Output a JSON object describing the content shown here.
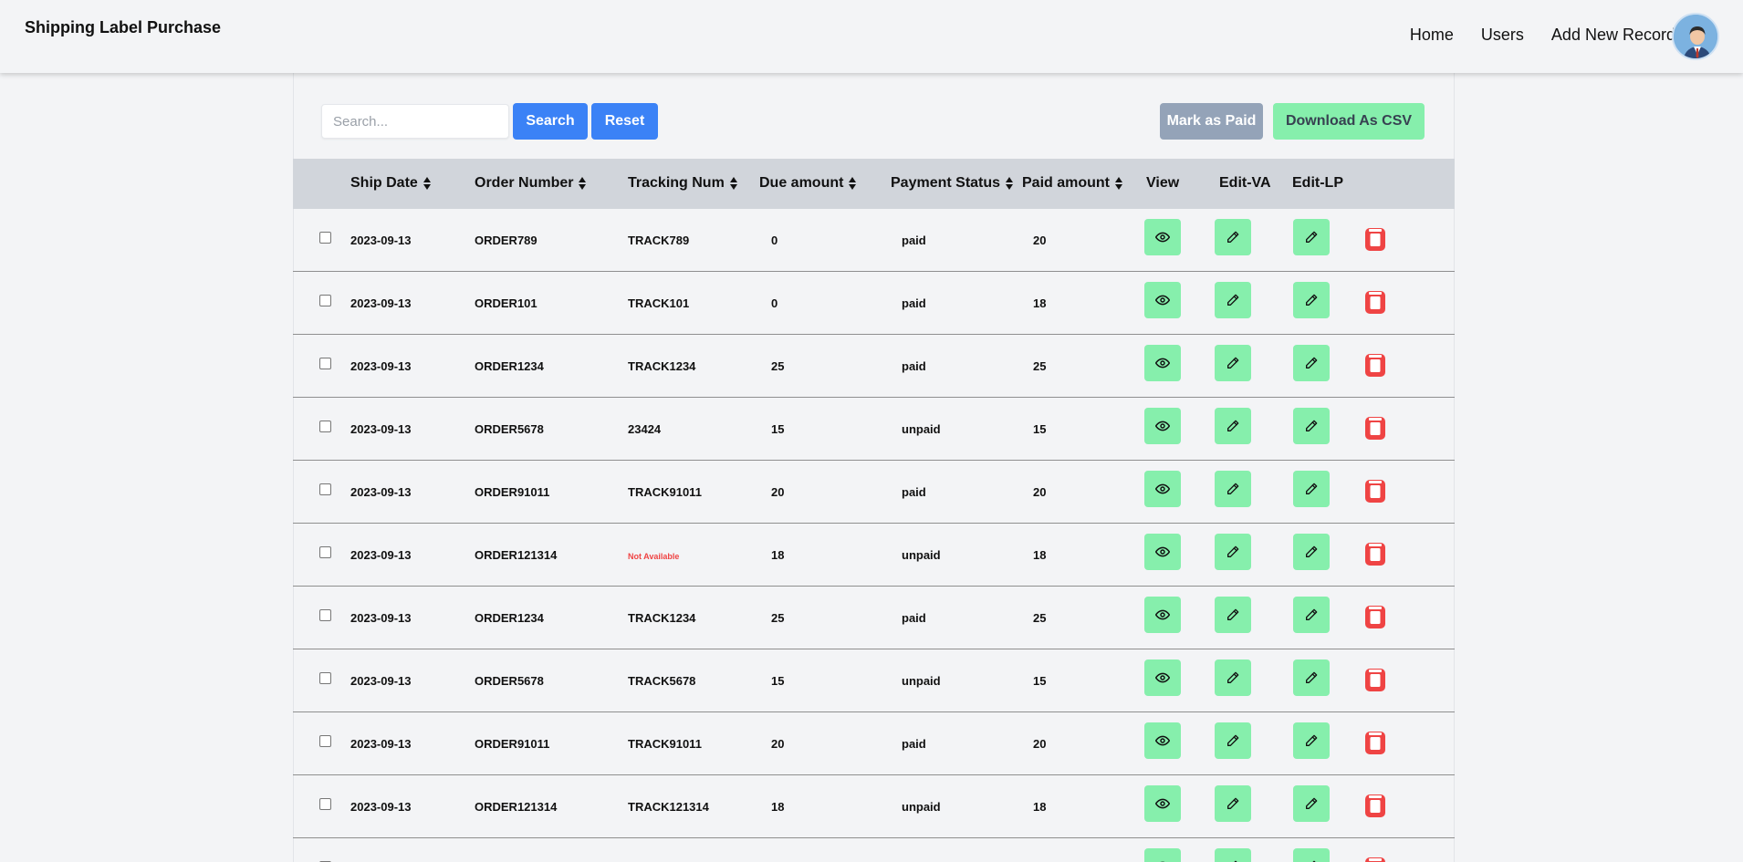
{
  "app": {
    "title": "Shipping Label Purchase",
    "nav": {
      "home": "Home",
      "users": "Users",
      "add_new_record": "Add New Record"
    }
  },
  "toolbar": {
    "search_placeholder": "Search...",
    "search_label": "Search",
    "reset_label": "Reset",
    "mark_paid_label": "Mark as Paid",
    "download_csv_label": "Download As CSV"
  },
  "table": {
    "columns": {
      "ship_date": "Ship Date",
      "order_number": "Order Number",
      "tracking_num": "Tracking Num",
      "due_amount": "Due amount",
      "payment_status": "Payment Status",
      "paid_amount": "Paid amount",
      "view": "View",
      "edit_va": "Edit-VA",
      "edit_lp": "Edit-LP"
    },
    "rows": [
      {
        "ship_date": "2023-09-13",
        "order": "ORDER789",
        "tracking": "TRACK789",
        "due": "0",
        "status": "paid",
        "paid": "20"
      },
      {
        "ship_date": "2023-09-13",
        "order": "ORDER101",
        "tracking": "TRACK101",
        "due": "0",
        "status": "paid",
        "paid": "18"
      },
      {
        "ship_date": "2023-09-13",
        "order": "ORDER1234",
        "tracking": "TRACK1234",
        "due": "25",
        "status": "paid",
        "paid": "25"
      },
      {
        "ship_date": "2023-09-13",
        "order": "ORDER5678",
        "tracking": "23424",
        "due": "15",
        "status": "unpaid",
        "paid": "15"
      },
      {
        "ship_date": "2023-09-13",
        "order": "ORDER91011",
        "tracking": "TRACK91011",
        "due": "20",
        "status": "paid",
        "paid": "20"
      },
      {
        "ship_date": "2023-09-13",
        "order": "ORDER121314",
        "tracking": "Not Available",
        "tracking_na": true,
        "due": "18",
        "status": "unpaid",
        "paid": "18"
      },
      {
        "ship_date": "2023-09-13",
        "order": "ORDER1234",
        "tracking": "TRACK1234",
        "due": "25",
        "status": "paid",
        "paid": "25"
      },
      {
        "ship_date": "2023-09-13",
        "order": "ORDER5678",
        "tracking": "TRACK5678",
        "due": "15",
        "status": "unpaid",
        "paid": "15"
      },
      {
        "ship_date": "2023-09-13",
        "order": "ORDER91011",
        "tracking": "TRACK91011",
        "due": "20",
        "status": "paid",
        "paid": "20"
      },
      {
        "ship_date": "2023-09-13",
        "order": "ORDER121314",
        "tracking": "TRACK121314",
        "due": "18",
        "status": "unpaid",
        "paid": "18"
      },
      {
        "ship_date": "",
        "order": "",
        "tracking": "",
        "due": "",
        "status": "",
        "paid": ""
      }
    ]
  },
  "icons": {
    "view": "eye-icon",
    "edit": "pencil-icon",
    "delete": "trash-icon",
    "sort": "sort-icon",
    "avatar": "user-avatar"
  },
  "colors": {
    "primary": "#3b82f6",
    "action_green": "#86efac",
    "disabled_gray": "#94a3b8",
    "delete_red": "#ef4444",
    "header_gray": "#d1d5db",
    "not_available_red": "#ef4444"
  }
}
